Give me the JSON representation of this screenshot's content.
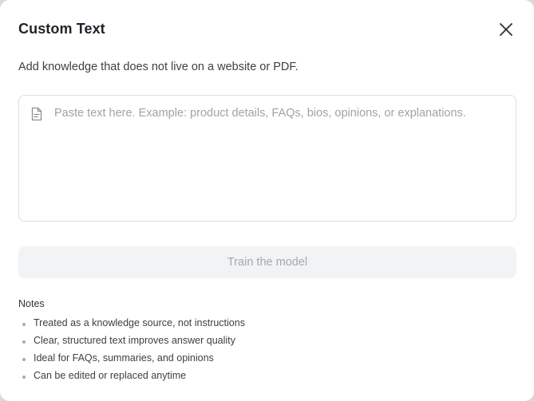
{
  "dialog": {
    "title": "Custom Text",
    "close_icon": "close-icon",
    "subtitle": "Add knowledge that does not live on a website or PDF."
  },
  "text_input": {
    "icon": "document-icon",
    "value": "",
    "placeholder": "Paste text here. Example: product details, FAQs, bios, opinions, or explanations."
  },
  "train_button": {
    "label": "Train the model",
    "enabled": false
  },
  "notes": {
    "heading": "Notes",
    "items": [
      "Treated as a knowledge source, not instructions",
      "Clear, structured text improves answer quality",
      "Ideal for FAQs, summaries, and opinions",
      "Can be edited or replaced anytime"
    ]
  },
  "colors": {
    "title_text": "#1f2328",
    "body_text": "#3b3f45",
    "placeholder_text": "#9ea3a9",
    "input_border": "#dcdee2",
    "button_bg_disabled": "#f2f3f5",
    "button_text_disabled": "#a4a8ad",
    "bullet": "#a7abb0"
  }
}
